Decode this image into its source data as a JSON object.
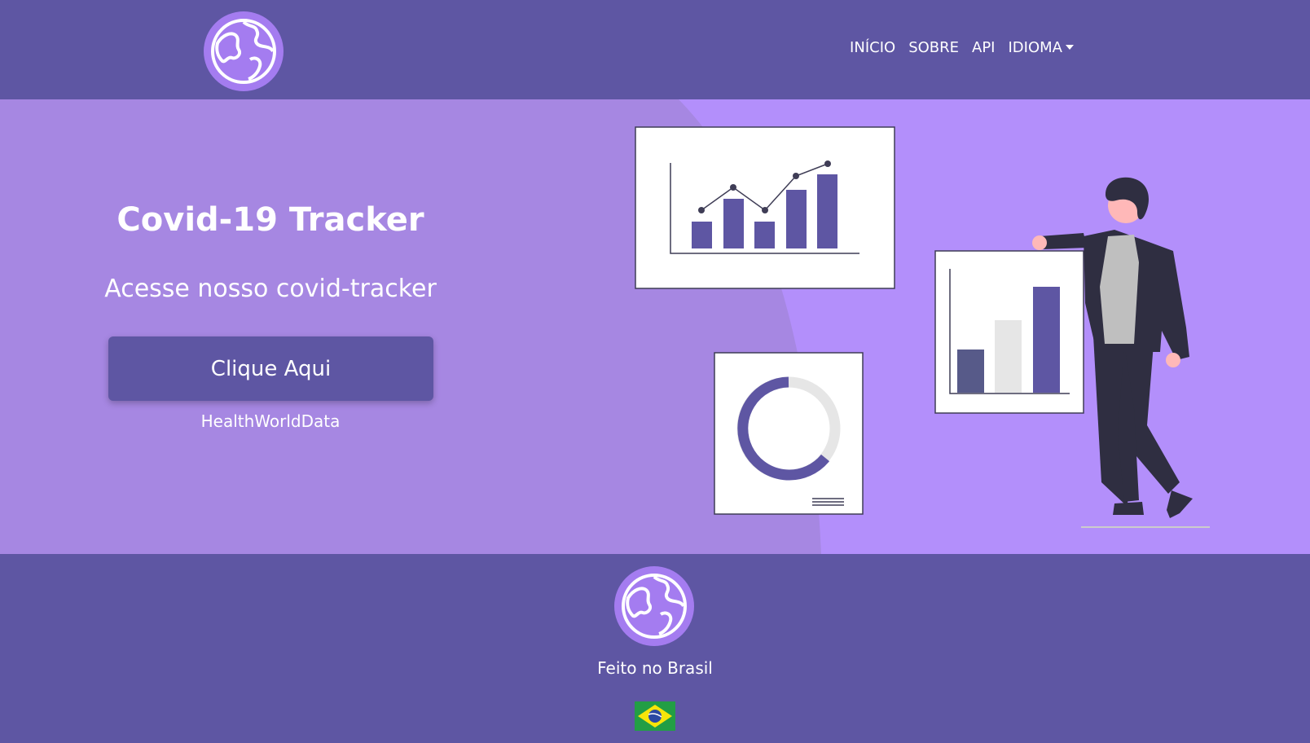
{
  "nav": {
    "links": [
      "INÍCIO",
      "SOBRE",
      "API",
      "IDIOMA"
    ]
  },
  "hero": {
    "title": "Covid-19 Tracker",
    "subtitle": "Acesse nosso covid-tracker",
    "button_label": "Clique Aqui",
    "brand": "HealthWorldData"
  },
  "footer": {
    "text": "Feito no Brasil"
  },
  "icons": {
    "logo": "globe-icon",
    "flag": "brazil-flag-icon",
    "dropdown": "caret-down-icon"
  },
  "colors": {
    "primary": "#5e56a3",
    "hero_light": "#b38ffb",
    "hero_dark": "#a687e2",
    "globe": "#a47cf0"
  }
}
